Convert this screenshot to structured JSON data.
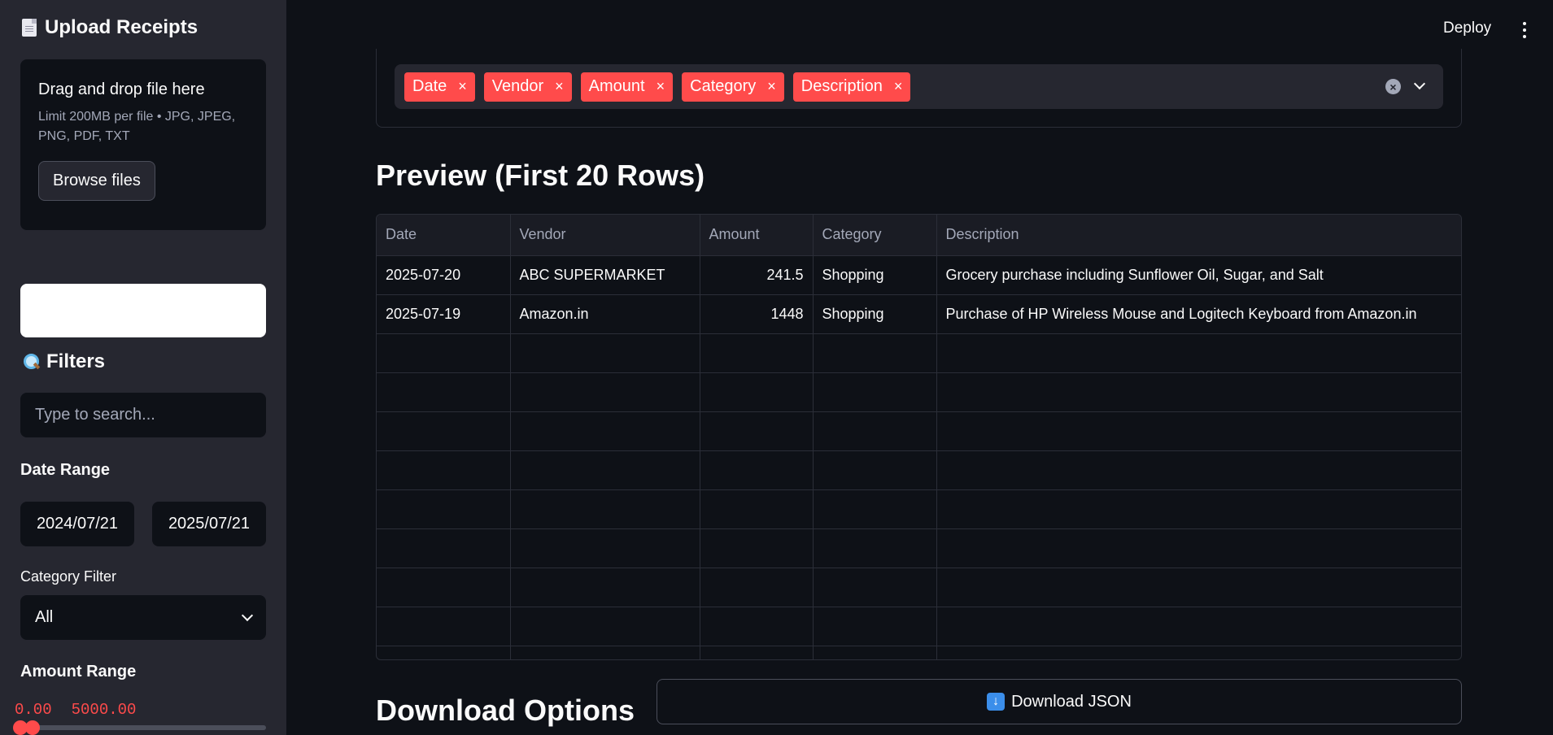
{
  "sidebar": {
    "upload_title": "Upload Receipts",
    "dropzone": {
      "title": "Drag and drop file here",
      "hint": "Limit 200MB per file • JPG, JPEG, PNG, PDF, TXT",
      "browse_label": "Browse files"
    },
    "filters_title": "Filters",
    "search_placeholder": "Type to search...",
    "date_range_label": "Date Range",
    "date_start": "2024/07/21",
    "date_end": "2025/07/21",
    "category_filter_label": "Category Filter",
    "category_selected": "All",
    "amount_range_label": "Amount Range",
    "amount_min": "0.00",
    "amount_max": "5000.00"
  },
  "header": {
    "deploy_label": "Deploy"
  },
  "columns_select": {
    "chips": [
      "Date",
      "Vendor",
      "Amount",
      "Category",
      "Description"
    ],
    "remove_glyph": "×"
  },
  "preview": {
    "title": "Preview (First 20 Rows)",
    "headers": [
      "Date",
      "Vendor",
      "Amount",
      "Category",
      "Description"
    ],
    "rows": [
      [
        "2025-07-20",
        "ABC SUPERMARKET",
        "241.5",
        "Shopping",
        "Grocery purchase including Sunflower Oil, Sugar, and Salt"
      ],
      [
        "2025-07-19",
        "Amazon.in",
        "1448",
        "Shopping",
        "Purchase of HP Wireless Mouse and Logitech Keyboard from Amazon.in"
      ]
    ],
    "empty_rows": 9
  },
  "download": {
    "title": "Download Options",
    "json_label": "Download JSON"
  },
  "colors": {
    "accent": "#ff4b4b",
    "background": "#0e1117",
    "sidebar": "#262730"
  }
}
